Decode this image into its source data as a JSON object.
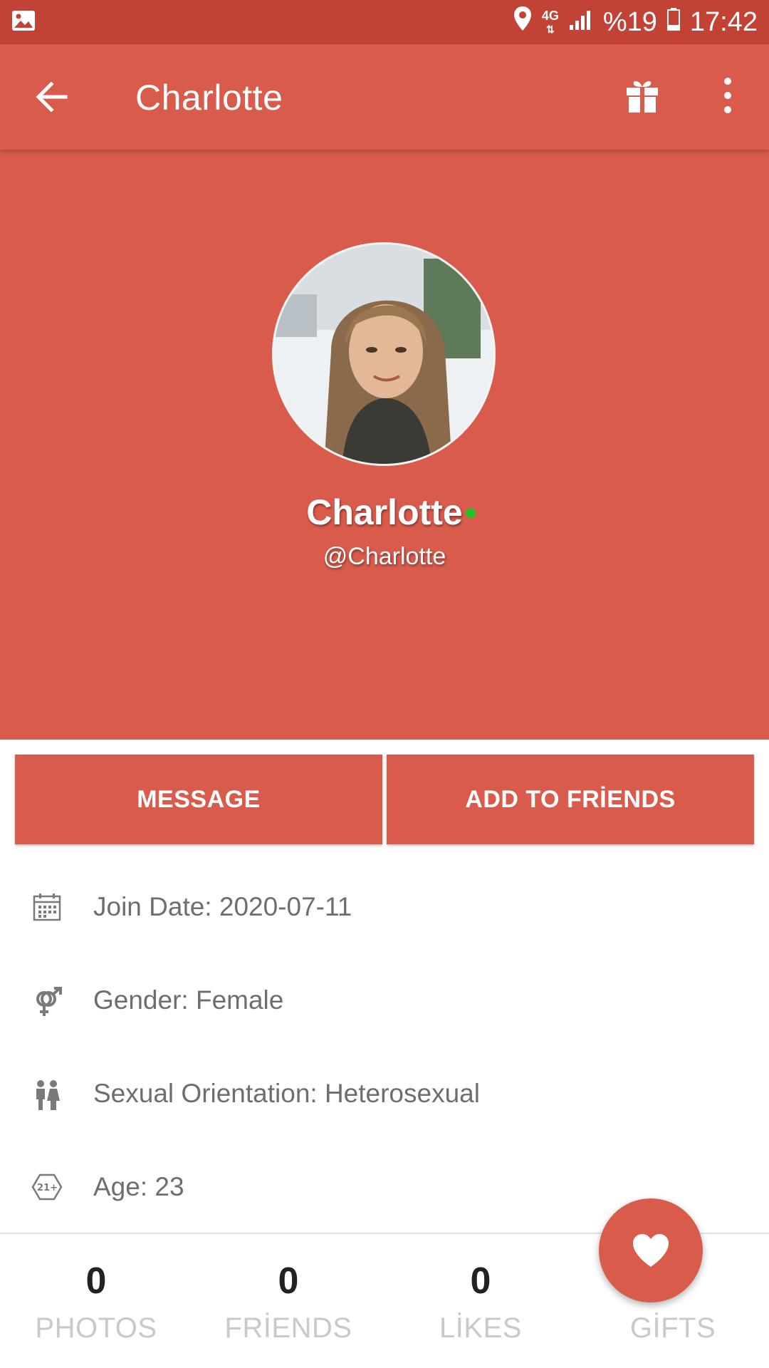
{
  "status_bar": {
    "network": "4G",
    "battery": "%19",
    "time": "17:42"
  },
  "app_bar": {
    "title": "Charlotte",
    "icons": [
      "back-arrow-icon",
      "gift-icon",
      "more-vert-icon"
    ]
  },
  "profile": {
    "name": "Charlotte",
    "handle": "@Charlotte",
    "online": true,
    "online_color": "#22c42a"
  },
  "actions": {
    "message_label": "MESSAGE",
    "add_friend_label": "ADD TO FRİENDS"
  },
  "info": [
    {
      "icon": "calendar-icon",
      "text": "Join Date: 2020-07-11"
    },
    {
      "icon": "gender-icon",
      "text": "Gender: Female"
    },
    {
      "icon": "couple-icon",
      "text": "Sexual Orientation: Heterosexual"
    },
    {
      "icon": "age-21-plus-icon",
      "text": "Age: 23"
    }
  ],
  "stats": [
    {
      "count": "0",
      "label": "PHOTOS"
    },
    {
      "count": "0",
      "label": "FRİENDS"
    },
    {
      "count": "0",
      "label": "LİKES"
    },
    {
      "count": "",
      "label": "GİFTS"
    }
  ],
  "fab_icon": "heart-icon",
  "colors": {
    "primary": "#d95b4c",
    "status_bar": "#c24236",
    "text_secondary": "#6e6e6e",
    "stat_label": "#c9c9c9"
  }
}
